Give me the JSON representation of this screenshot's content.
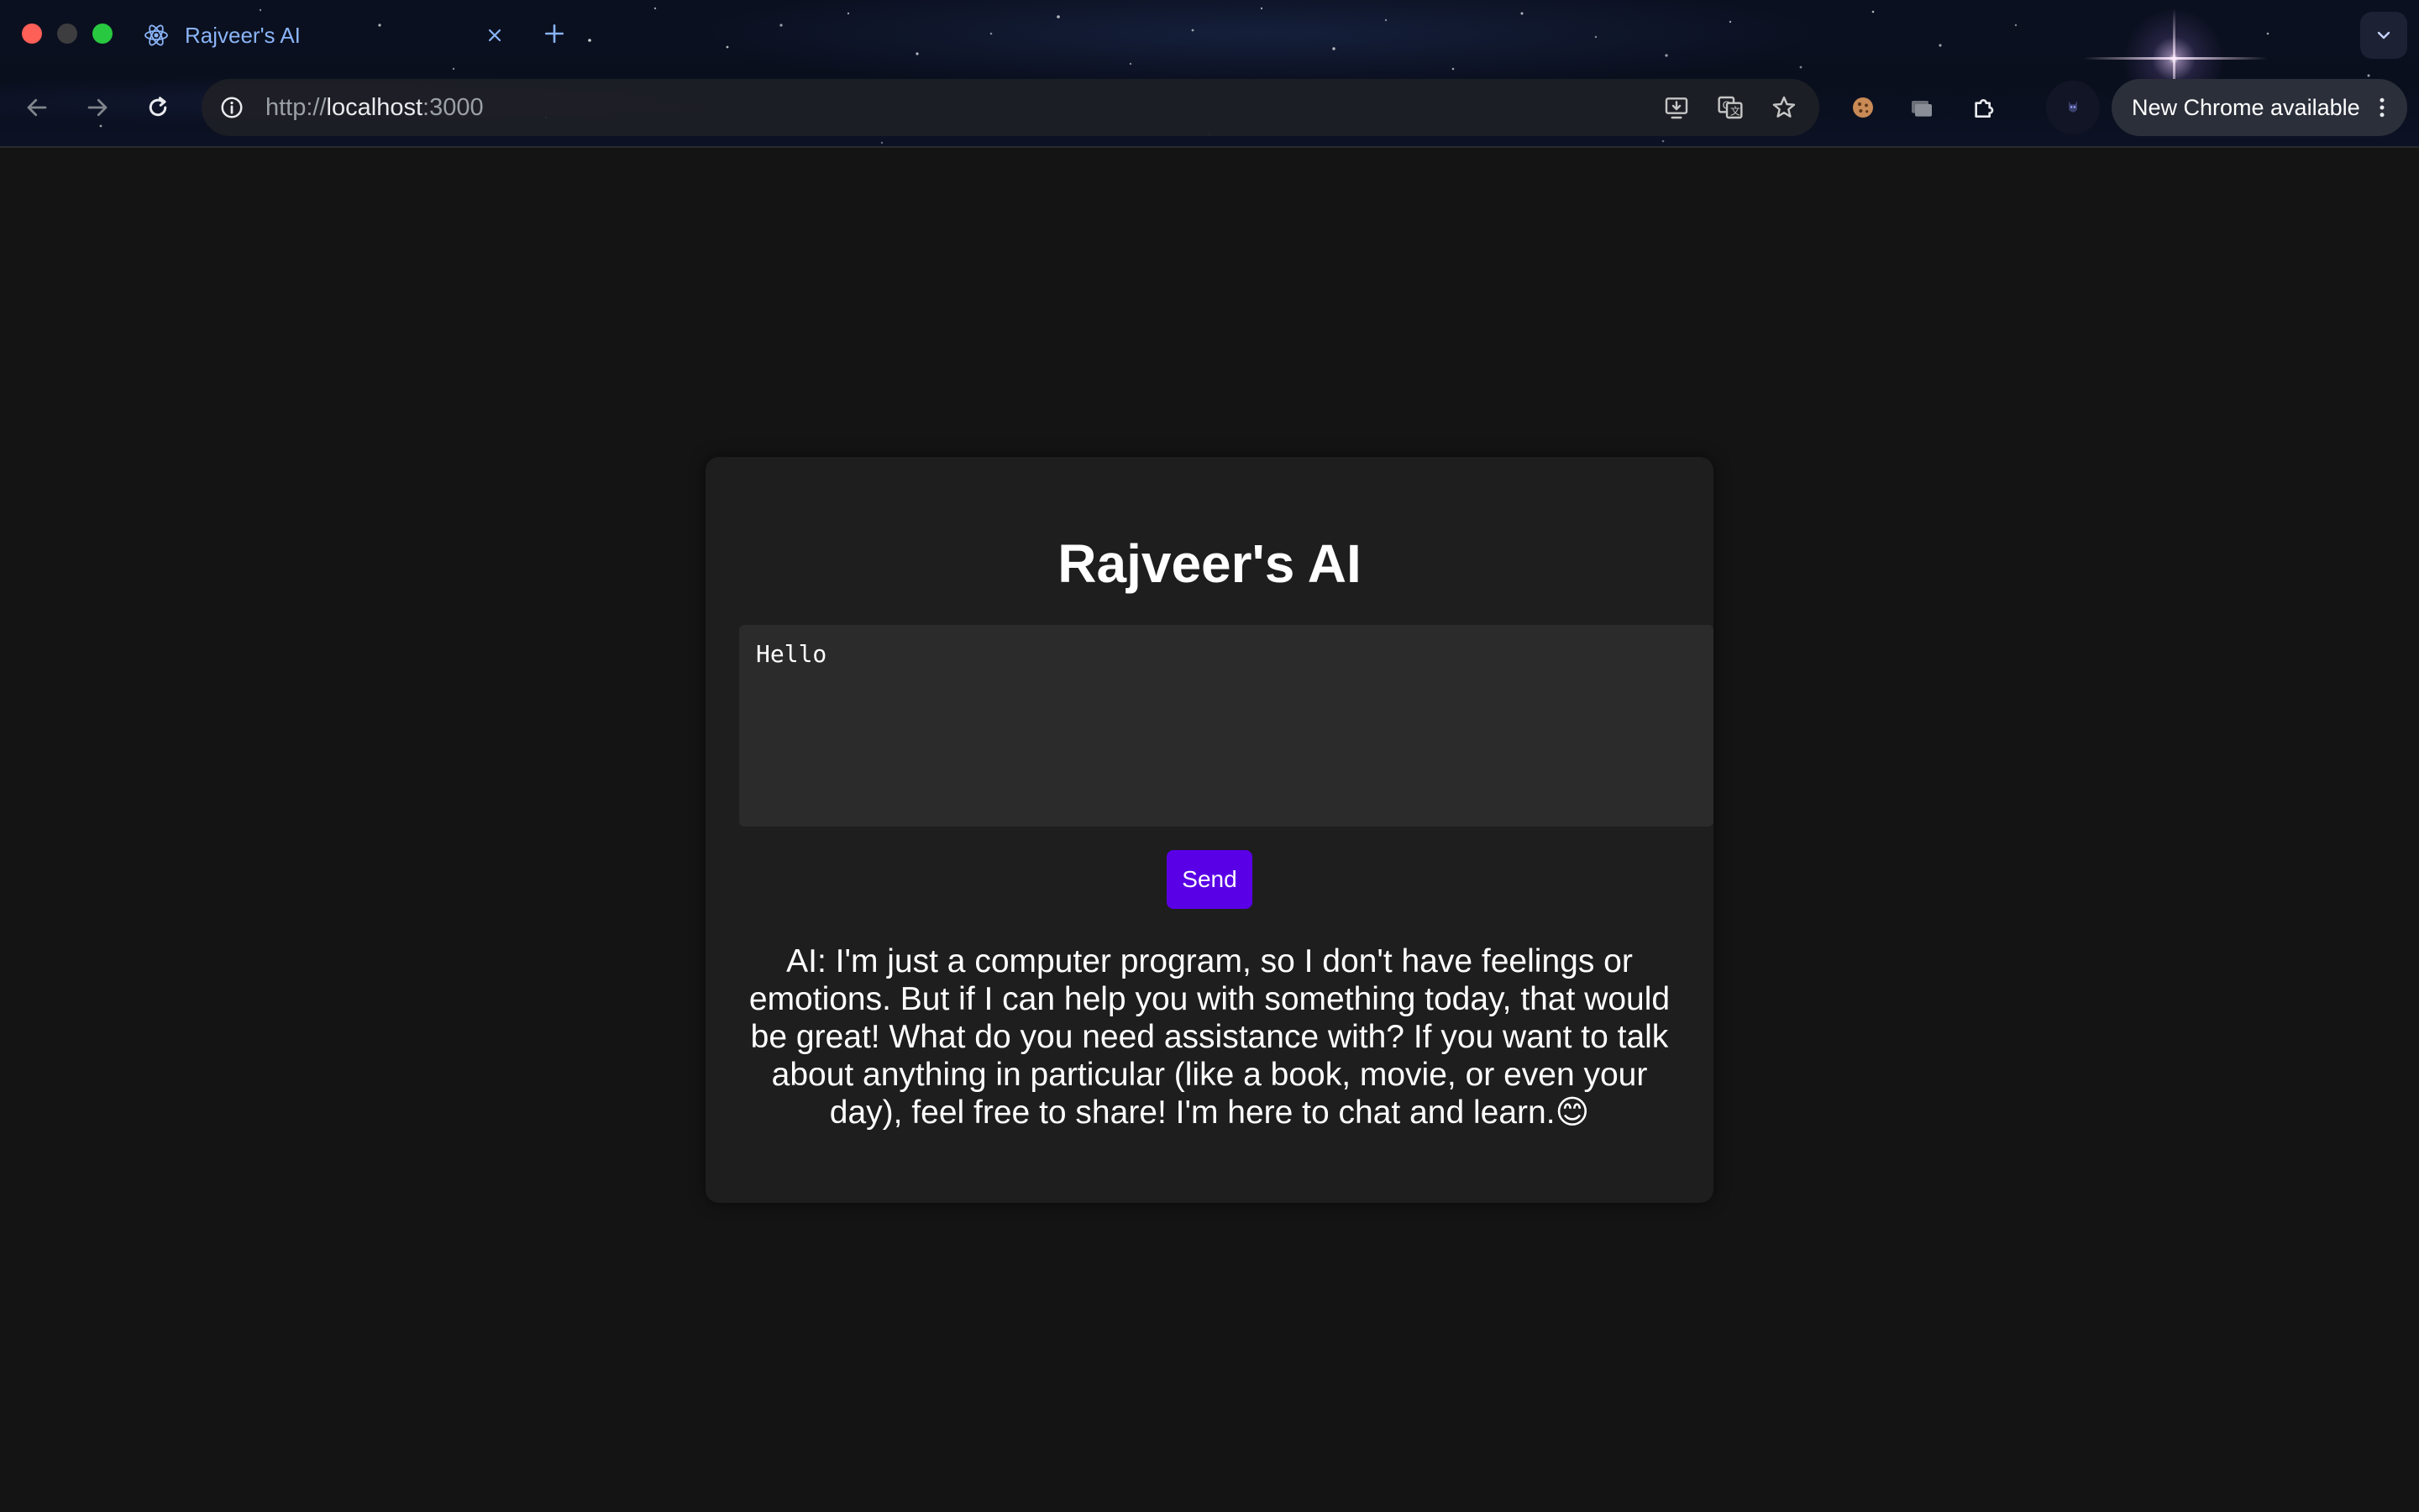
{
  "browser": {
    "tab": {
      "title": "Rajveer's AI"
    },
    "address_bar": {
      "scheme": "http://",
      "host": "localhost",
      "port": ":3000"
    },
    "update_button": {
      "label": "New Chrome available"
    },
    "icons": {
      "favicon": "react-atom-icon",
      "close": "close-icon",
      "new_tab": "plus-icon",
      "tab_search": "chevron-down-icon",
      "back": "arrow-left-icon",
      "forward": "arrow-right-icon",
      "reload": "reload-icon",
      "site_info": "info-icon",
      "install": "install-app-icon",
      "translate": "translate-icon",
      "bookmark": "star-icon",
      "cookie_extension": "cookie-icon",
      "cast": "cast-icon",
      "extensions": "puzzle-icon",
      "profile": "avatar",
      "menu": "kebab-menu-icon"
    }
  },
  "app": {
    "title": "Rajveer's AI",
    "prompt_value": "Hello",
    "send_label": "Send",
    "response": "AI: I'm just a computer program, so I don't have feelings or emotions. But if I can help you with something today, that would be great! What do you need assistance with? If you want to talk about anything in particular (like a book, movie, or even your day), feel free to share! I'm here to chat and learn.😊"
  },
  "colors": {
    "page_background": "#141414",
    "card_background": "#1e1e1e",
    "textarea_background": "#2b2b2b",
    "send_button": "#5a00e6",
    "tab_title": "#8ab4f8"
  }
}
